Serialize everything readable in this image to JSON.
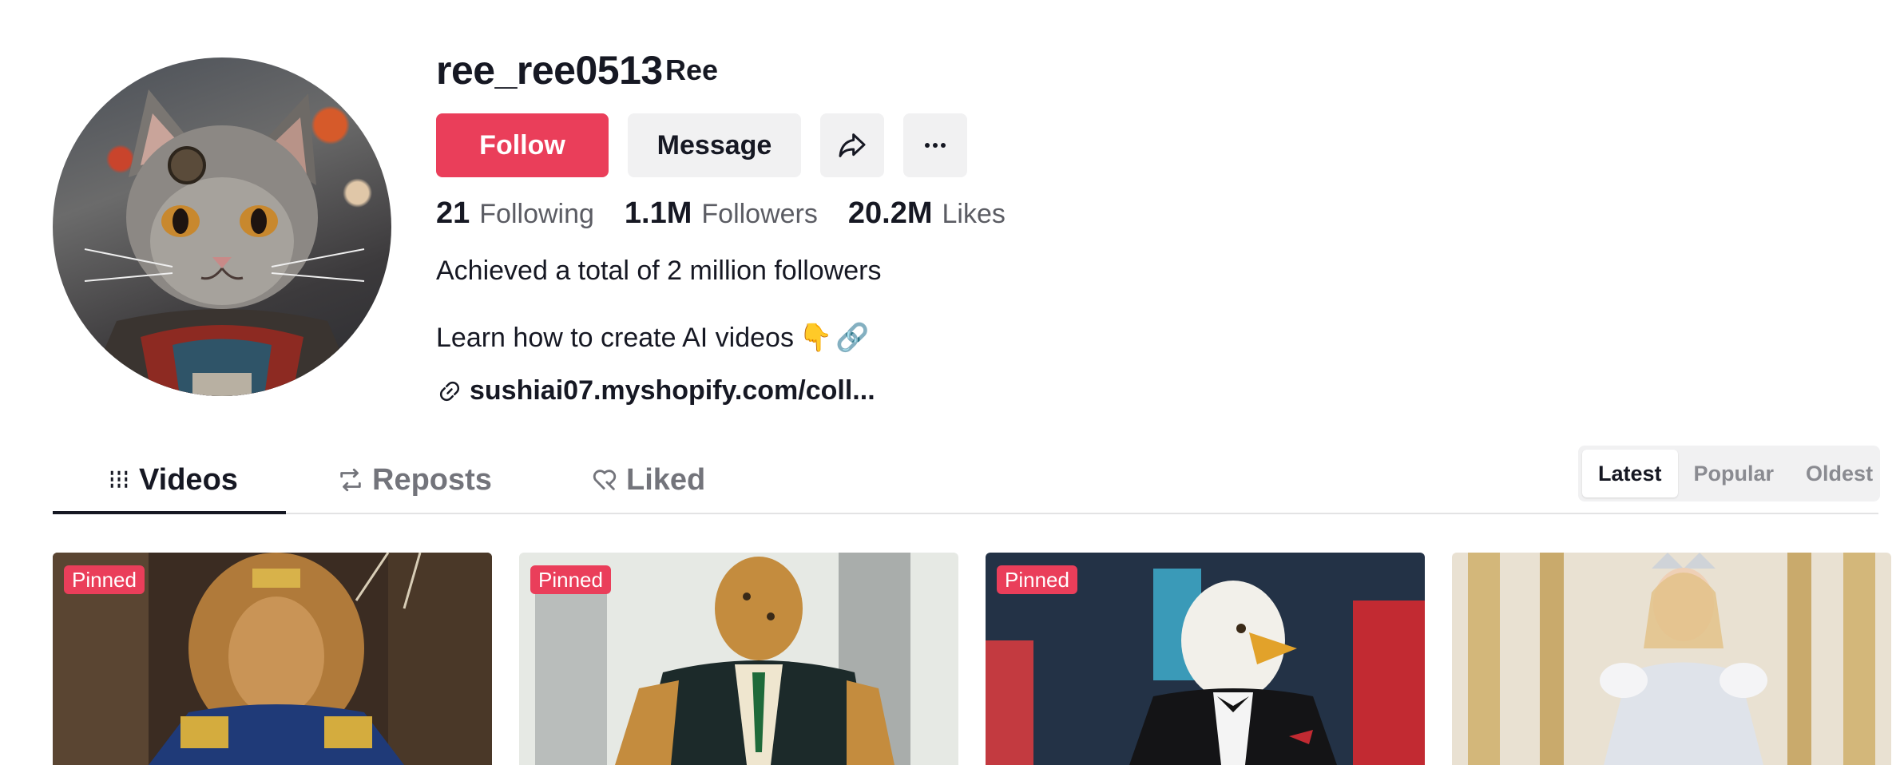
{
  "profile": {
    "username": "ree_ree0513",
    "nickname": "Ree",
    "avatar_icon": "cat-avatar"
  },
  "actions": {
    "follow_label": "Follow",
    "message_label": "Message",
    "share_icon": "share-icon",
    "more_icon": "more-icon",
    "follow_color": "#ea3e5a"
  },
  "stats": [
    {
      "value": "21",
      "label": "Following"
    },
    {
      "value": "1.1M",
      "label": "Followers"
    },
    {
      "value": "20.2M",
      "label": "Likes"
    }
  ],
  "bio": {
    "line1": "Achieved a total of 2 million followers",
    "line2": "Learn how to create AI videos",
    "line2_emojis": [
      "👇",
      "🔗"
    ],
    "link": "sushiai07.myshopify.com/coll..."
  },
  "tabs": [
    {
      "label": "Videos",
      "active": true
    },
    {
      "label": "Reposts",
      "active": false
    },
    {
      "label": "Liked",
      "active": false
    }
  ],
  "sort": {
    "options": [
      "Latest",
      "Popular",
      "Oldest"
    ],
    "selected": "Latest"
  },
  "videos": [
    {
      "badge": "Pinned",
      "subject": "lion-in-royal-uniform"
    },
    {
      "badge": "Pinned",
      "subject": "leopard-in-suit"
    },
    {
      "badge": "Pinned",
      "subject": "eagle-in-tuxedo"
    },
    {
      "badge": "",
      "subject": "princess-in-gown"
    }
  ]
}
